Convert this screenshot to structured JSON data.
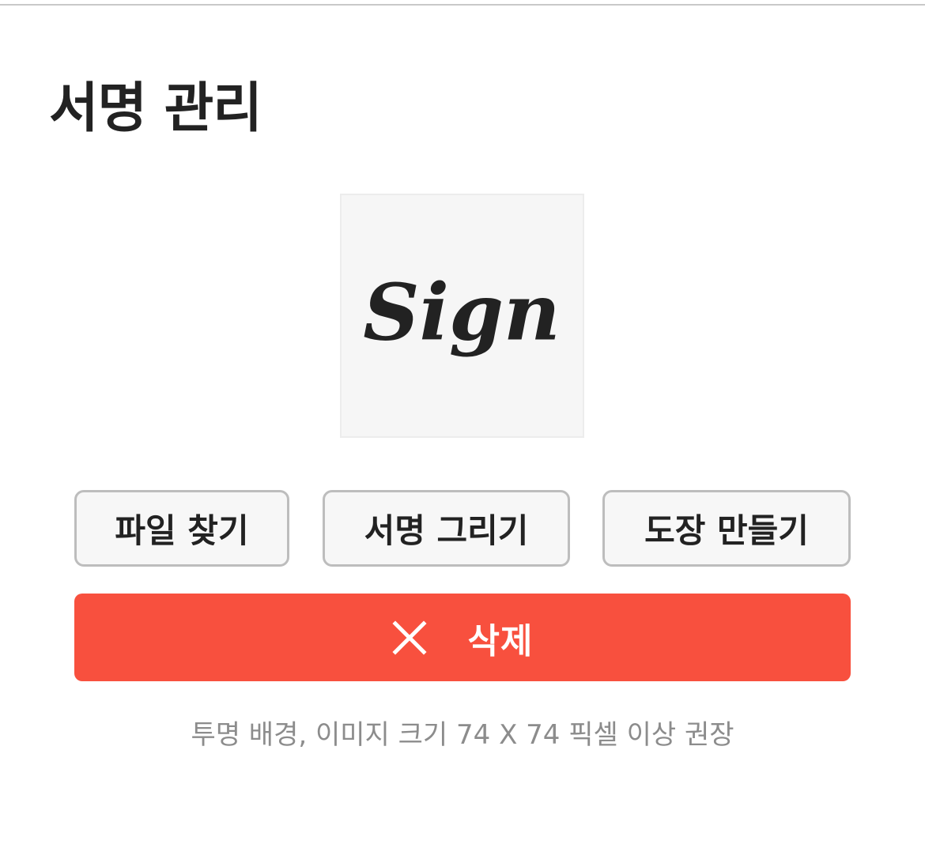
{
  "page": {
    "title": "서명 관리"
  },
  "preview": {
    "signature_text": "Sign"
  },
  "actions": {
    "file_label": "파일 찾기",
    "draw_label": "서명 그리기",
    "stamp_label": "도장 만들기",
    "delete_label": "삭제",
    "delete_icon": "close-icon"
  },
  "hint": {
    "text": "투명 배경, 이미지 크기 74 X 74 픽셀 이상 권장"
  },
  "colors": {
    "delete_bg": "#f8503e",
    "title_text": "#222222",
    "hint_text": "#8c8c8c",
    "button_border": "#bdbdbd",
    "button_bg": "#f7f7f7",
    "preview_bg": "#f6f6f6"
  }
}
